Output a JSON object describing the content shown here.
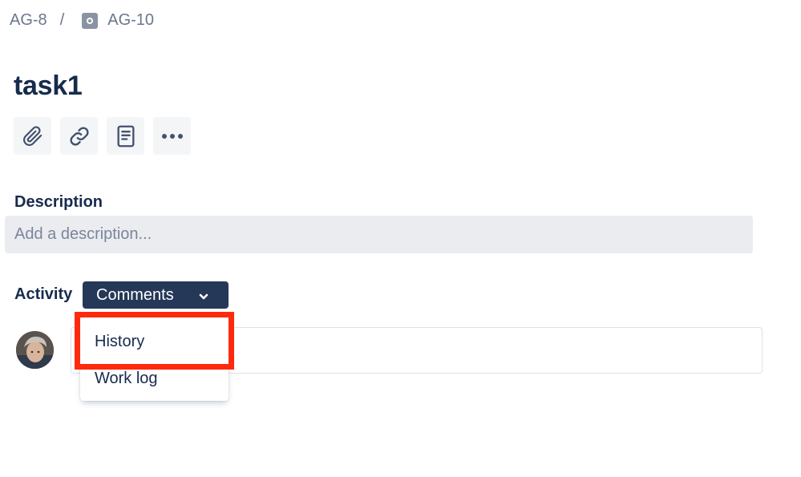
{
  "breadcrumb": {
    "parent": "AG-8",
    "separator": "/",
    "current": "AG-10",
    "current_icon": "issue-type-icon"
  },
  "issue": {
    "title": "task1"
  },
  "toolbar": {
    "buttons": [
      {
        "icon": "paperclip-icon",
        "action": "attach"
      },
      {
        "icon": "link-icon",
        "action": "link-issue"
      },
      {
        "icon": "page-icon",
        "action": "add-page"
      },
      {
        "icon": "more-icon",
        "action": "more"
      }
    ]
  },
  "description": {
    "label": "Description",
    "placeholder": "Add a description..."
  },
  "activity": {
    "label": "Activity",
    "selected": "Comments",
    "options": [
      "History",
      "Work log"
    ]
  },
  "colors": {
    "text_primary": "#172b4d",
    "text_subtle": "#6b778c",
    "button_dark": "#253858",
    "surface_gray": "#ebecf0",
    "highlight": "#ff2a0d"
  }
}
